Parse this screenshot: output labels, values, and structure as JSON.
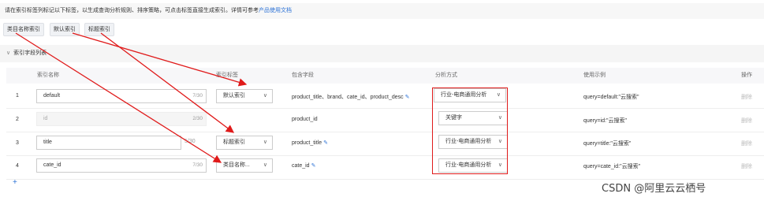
{
  "notice": {
    "text": "请在索引标签列标记以下标签，以生成查询分析规则、排序策略，可点击标签直接生成索引。详情可参考",
    "link": "产品使用文档"
  },
  "tags": [
    "类目名称索引",
    "默认索引",
    "标题索引"
  ],
  "section_title": "索引字段列表",
  "columns": [
    "索引名称",
    "索引标签",
    "包含字段",
    "分析方式",
    "使用示例",
    "操作"
  ],
  "rows": [
    {
      "num": "1",
      "name": "default",
      "count": "7/30",
      "label": "默认索引",
      "fields": "product_title、brand、cate_id、product_desc",
      "analyzer": "行业-电商通用分析",
      "example": "query=default:\"云搜索\"",
      "action": "删除",
      "name_disabled": false,
      "has_label": true
    },
    {
      "num": "2",
      "name": "id",
      "count": "2/30",
      "label": "",
      "fields": "product_id",
      "analyzer": "关键字",
      "example": "query=id:\"云搜索\"",
      "action": "删除",
      "name_disabled": true,
      "has_label": false
    },
    {
      "num": "3",
      "name": "title",
      "count": "5/30",
      "label": "标题索引",
      "fields": "product_title",
      "analyzer": "行业-电商通用分析",
      "example": "query=title:\"云搜索\"",
      "action": "删除",
      "name_disabled": false,
      "has_label": true
    },
    {
      "num": "4",
      "name": "cate_id",
      "count": "7/30",
      "label": "类目名称...",
      "fields": "cate_id",
      "analyzer": "行业-电商通用分析",
      "example": "query=cate_id:\"云搜索\"",
      "action": "删除",
      "name_disabled": false,
      "has_label": true
    }
  ],
  "add_icon": "+",
  "watermark": "CSDN @阿里云云栖号",
  "colors": {
    "accent": "#2c72d6",
    "annotation": "#e01a1a"
  }
}
